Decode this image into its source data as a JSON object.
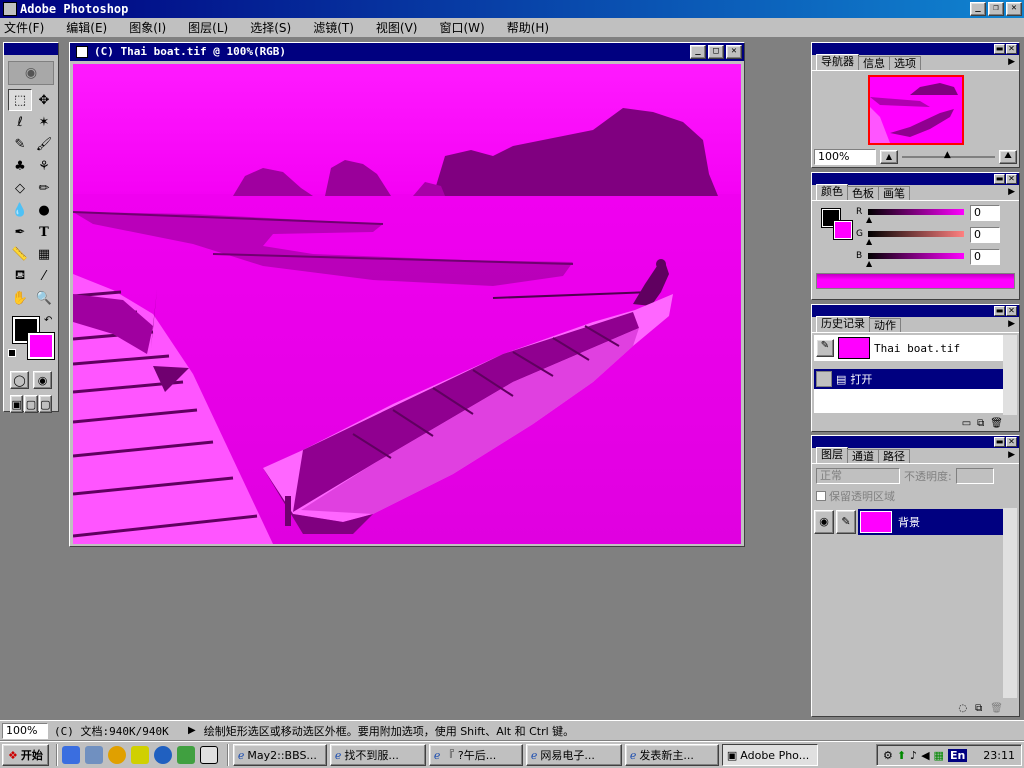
{
  "window": {
    "title": "Adobe Photoshop"
  },
  "menu": [
    "文件(F)",
    "编辑(E)",
    "图象(I)",
    "图层(L)",
    "选择(S)",
    "滤镜(T)",
    "视图(V)",
    "窗口(W)",
    "帮助(H)"
  ],
  "document": {
    "title": "(C) Thai boat.tif @ 100%(RGB)",
    "tint": "#ff00ff"
  },
  "navigator": {
    "tabs": [
      "导航器",
      "信息",
      "选项"
    ],
    "zoom": "100%"
  },
  "color": {
    "tabs": [
      "颜色",
      "色板",
      "画笔"
    ],
    "r_label": "R",
    "g_label": "G",
    "b_label": "B",
    "r": "0",
    "g": "0",
    "b": "0"
  },
  "history": {
    "tabs": [
      "历史记录",
      "动作"
    ],
    "snapshot": "Thai boat.tif",
    "step": "打开"
  },
  "layers": {
    "tabs": [
      "图层",
      "通道",
      "路径"
    ],
    "blend": "正常",
    "opacity_label": "不透明度:",
    "preserve": "保留透明区域",
    "layer_name": "背景"
  },
  "status": {
    "zoom": "100%",
    "doc": "(C) 文档:940K/940K",
    "hint": "绘制矩形选区或移动选区外框。要用附加选项，使用 Shift、Alt 和 Ctrl 键。"
  },
  "taskbar": {
    "start": "开始",
    "tasks": [
      "May2::BBS...",
      "找不到服...",
      "『 ?午后...",
      "网易电子...",
      "发表新主...",
      "Adobe Pho..."
    ],
    "lang": "En",
    "time": "23:11"
  },
  "colors": {
    "magenta": "#ff00ff",
    "titlebar": "#000080",
    "face": "#c0c0c0"
  }
}
